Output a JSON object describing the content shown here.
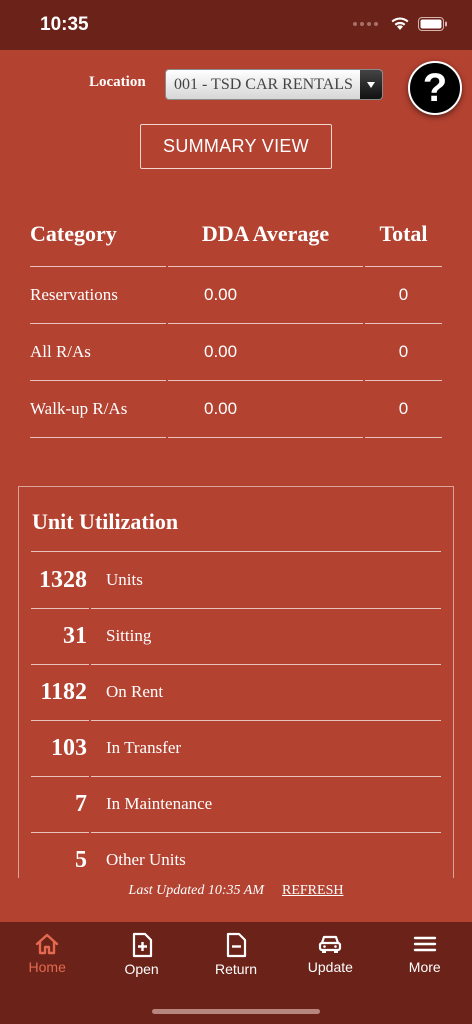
{
  "status_bar": {
    "time": "10:35"
  },
  "location": {
    "label": "Location",
    "selected": "001 - TSD CAR RENTALS"
  },
  "help_button": {
    "label": "?"
  },
  "summary_button": {
    "label": "SUMMARY VIEW"
  },
  "dda_table": {
    "headers": [
      "Category",
      "DDA Average",
      "Total"
    ],
    "rows": [
      {
        "category": "Reservations",
        "average": "0.00",
        "total": "0"
      },
      {
        "category": "All R/As",
        "average": "0.00",
        "total": "0"
      },
      {
        "category": "Walk-up R/As",
        "average": "0.00",
        "total": "0"
      }
    ]
  },
  "unit_utilization": {
    "title": "Unit Utilization",
    "rows": [
      {
        "count": "1328",
        "label": "Units"
      },
      {
        "count": "31",
        "label": "Sitting"
      },
      {
        "count": "1182",
        "label": "On Rent"
      },
      {
        "count": "103",
        "label": "In Transfer"
      },
      {
        "count": "7",
        "label": "In Maintenance"
      },
      {
        "count": "5",
        "label": "Other Units"
      }
    ]
  },
  "footer": {
    "last_updated": "Last Updated 10:35 AM",
    "refresh": "REFRESH"
  },
  "tabs": [
    {
      "label": "Home",
      "icon": "home-icon",
      "active": true
    },
    {
      "label": "Open",
      "icon": "document-add-icon",
      "active": false
    },
    {
      "label": "Return",
      "icon": "document-remove-icon",
      "active": false
    },
    {
      "label": "Update",
      "icon": "car-icon",
      "active": false
    },
    {
      "label": "More",
      "icon": "menu-icon",
      "active": false
    }
  ],
  "colors": {
    "background": "#b34231",
    "bars": "#6b2218",
    "active_tab": "#e36a50"
  }
}
